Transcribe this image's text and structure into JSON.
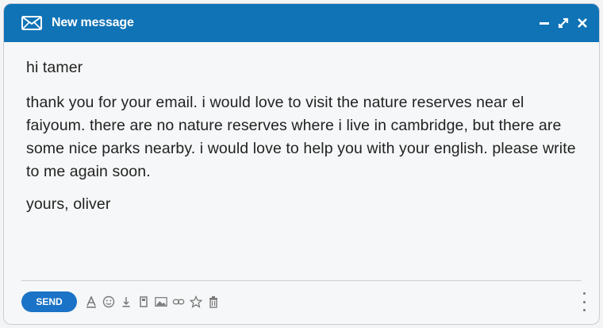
{
  "window": {
    "title": "New message",
    "controls": [
      "minimize-icon",
      "expand-icon",
      "close-icon"
    ]
  },
  "message": {
    "greeting": "hi tamer",
    "paragraph": "thank you for your email. i would love to visit the nature reserves near el faiyoum. there are no nature reserves where i live in cambridge, but there are some nice parks nearby. i would love to help you with your english. please write to me again soon.",
    "closing": "yours,  oliver"
  },
  "toolbar": {
    "send_label": "SEND",
    "tools": [
      "format-text-icon",
      "emoji-icon",
      "attach-icon",
      "drive-icon",
      "photo-icon",
      "link-icon",
      "star-icon",
      "trash-icon"
    ],
    "more": "more-options-icon"
  },
  "colors": {
    "titlebar": "#0f73b6",
    "send_button": "#1a73c7",
    "background": "#f6f7f8"
  }
}
